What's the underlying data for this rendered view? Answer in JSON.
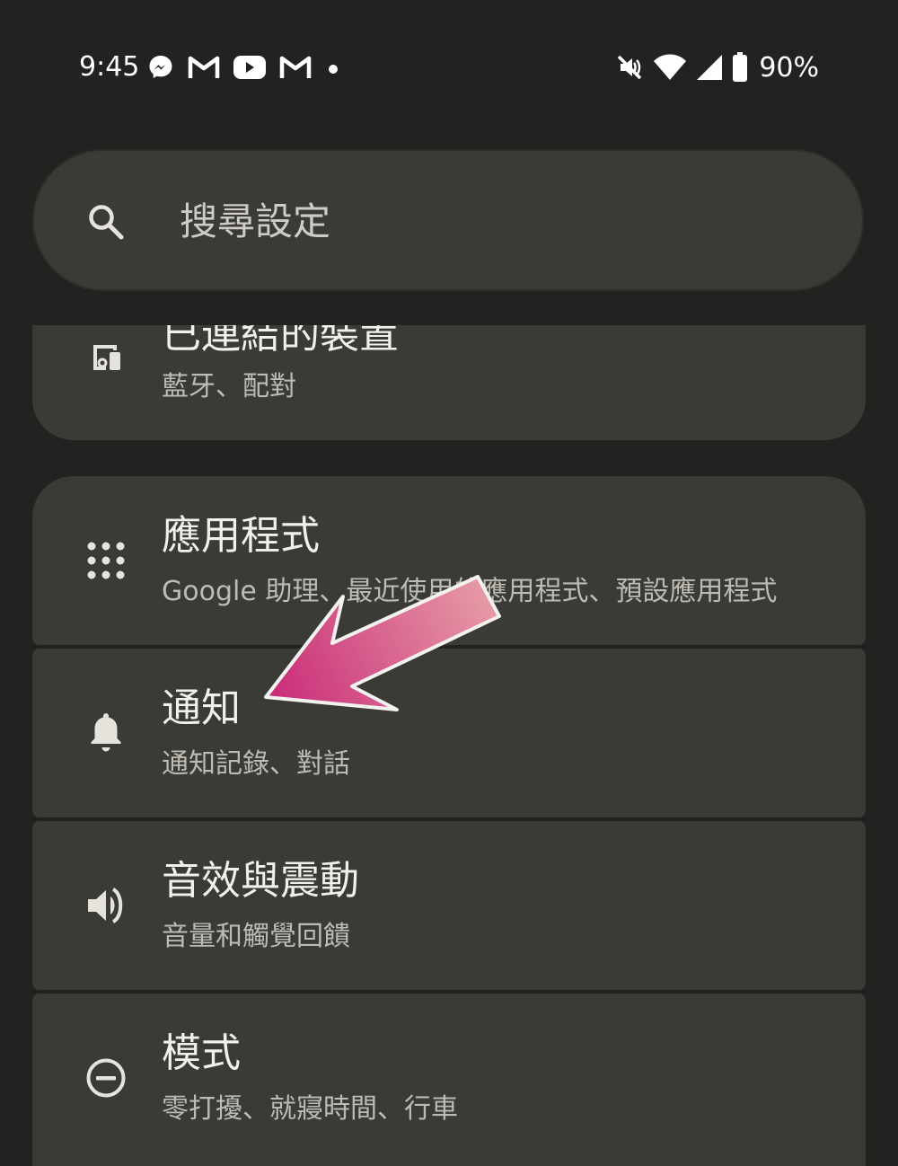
{
  "status_bar": {
    "time": "9:45",
    "left_icons": [
      "messenger-icon",
      "gmail-icon",
      "youtube-icon",
      "gmail-icon",
      "dot-icon"
    ],
    "right_icons": [
      "mute-vibrate-icon",
      "wifi-icon",
      "signal-icon",
      "battery-icon"
    ],
    "battery_percent": "90%"
  },
  "search": {
    "placeholder": "搜尋設定"
  },
  "settings": {
    "items": [
      {
        "icon": "connected-devices-icon",
        "title": "已連結的裝置",
        "subtitle": "藍牙、配對"
      },
      {
        "icon": "apps-grid-icon",
        "title": "應用程式",
        "subtitle": "Google 助理、最近使用的應用程式、預設應用程式"
      },
      {
        "icon": "bell-icon",
        "title": "通知",
        "subtitle": "通知記錄、對話"
      },
      {
        "icon": "volume-icon",
        "title": "音效與震動",
        "subtitle": "音量和觸覺回饋"
      },
      {
        "icon": "modes-icon",
        "title": "模式",
        "subtitle": "零打擾、就寢時間、行車"
      }
    ]
  },
  "annotation": {
    "arrow_color_start": "#c92b78",
    "arrow_color_end": "#e8a0a8",
    "points_to": "通知"
  },
  "colors": {
    "background": "#222320",
    "card": "#3a3a37",
    "title_text": "#f2f0ea",
    "subtitle_text": "#bebbb3"
  }
}
